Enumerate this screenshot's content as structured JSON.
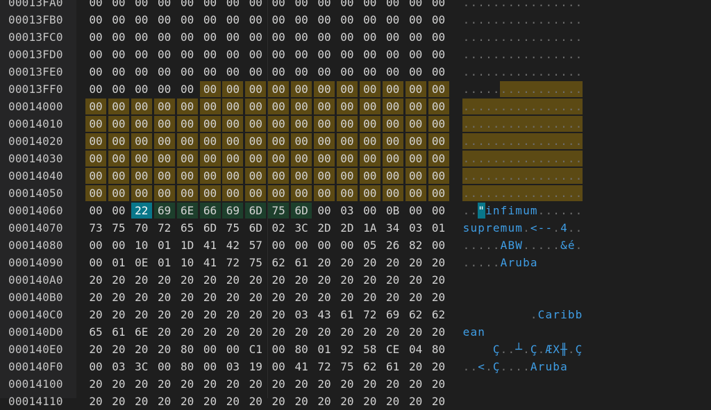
{
  "hex_editor": {
    "rows": [
      {
        "offset": "00013FA0",
        "bytes": [
          "00",
          "00",
          "00",
          "00",
          "00",
          "00",
          "00",
          "00",
          "00",
          "00",
          "00",
          "00",
          "00",
          "00",
          "00",
          "00"
        ],
        "ascii": "................"
      },
      {
        "offset": "00013FB0",
        "bytes": [
          "00",
          "00",
          "00",
          "00",
          "00",
          "00",
          "00",
          "00",
          "00",
          "00",
          "00",
          "00",
          "00",
          "00",
          "00",
          "00"
        ],
        "ascii": "................"
      },
      {
        "offset": "00013FC0",
        "bytes": [
          "00",
          "00",
          "00",
          "00",
          "00",
          "00",
          "00",
          "00",
          "00",
          "00",
          "00",
          "00",
          "00",
          "00",
          "00",
          "00"
        ],
        "ascii": "................"
      },
      {
        "offset": "00013FD0",
        "bytes": [
          "00",
          "00",
          "00",
          "00",
          "00",
          "00",
          "00",
          "00",
          "00",
          "00",
          "00",
          "00",
          "00",
          "00",
          "00",
          "00"
        ],
        "ascii": "................"
      },
      {
        "offset": "00013FE0",
        "bytes": [
          "00",
          "00",
          "00",
          "00",
          "00",
          "00",
          "00",
          "00",
          "00",
          "00",
          "00",
          "00",
          "00",
          "00",
          "00",
          "00"
        ],
        "ascii": "................"
      },
      {
        "offset": "00013FF0",
        "bytes": [
          "00",
          "00",
          "00",
          "00",
          "00",
          "00",
          "00",
          "00",
          "00",
          "00",
          "00",
          "00",
          "00",
          "00",
          "00",
          "00"
        ],
        "ascii": "................"
      },
      {
        "offset": "00014000",
        "bytes": [
          "00",
          "00",
          "00",
          "00",
          "00",
          "00",
          "00",
          "00",
          "00",
          "00",
          "00",
          "00",
          "00",
          "00",
          "00",
          "00"
        ],
        "ascii": "................"
      },
      {
        "offset": "00014010",
        "bytes": [
          "00",
          "00",
          "00",
          "00",
          "00",
          "00",
          "00",
          "00",
          "00",
          "00",
          "00",
          "00",
          "00",
          "00",
          "00",
          "00"
        ],
        "ascii": "................"
      },
      {
        "offset": "00014020",
        "bytes": [
          "00",
          "00",
          "00",
          "00",
          "00",
          "00",
          "00",
          "00",
          "00",
          "00",
          "00",
          "00",
          "00",
          "00",
          "00",
          "00"
        ],
        "ascii": "................"
      },
      {
        "offset": "00014030",
        "bytes": [
          "00",
          "00",
          "00",
          "00",
          "00",
          "00",
          "00",
          "00",
          "00",
          "00",
          "00",
          "00",
          "00",
          "00",
          "00",
          "00"
        ],
        "ascii": "................"
      },
      {
        "offset": "00014040",
        "bytes": [
          "00",
          "00",
          "00",
          "00",
          "00",
          "00",
          "00",
          "00",
          "00",
          "00",
          "00",
          "00",
          "00",
          "00",
          "00",
          "00"
        ],
        "ascii": "................"
      },
      {
        "offset": "00014050",
        "bytes": [
          "00",
          "00",
          "00",
          "00",
          "00",
          "00",
          "00",
          "00",
          "00",
          "00",
          "00",
          "00",
          "00",
          "00",
          "00",
          "00"
        ],
        "ascii": "................"
      },
      {
        "offset": "00014060",
        "bytes": [
          "00",
          "00",
          "22",
          "69",
          "6E",
          "66",
          "69",
          "6D",
          "75",
          "6D",
          "00",
          "03",
          "00",
          "0B",
          "00",
          "00"
        ],
        "ascii": "..\"infimum......"
      },
      {
        "offset": "00014070",
        "bytes": [
          "73",
          "75",
          "70",
          "72",
          "65",
          "6D",
          "75",
          "6D",
          "02",
          "3C",
          "2D",
          "2D",
          "1A",
          "34",
          "03",
          "01"
        ],
        "ascii": "supremum.<--.4.."
      },
      {
        "offset": "00014080",
        "bytes": [
          "00",
          "00",
          "10",
          "01",
          "1D",
          "41",
          "42",
          "57",
          "00",
          "00",
          "00",
          "00",
          "05",
          "26",
          "82",
          "00"
        ],
        "ascii": ".....ABW.....&é."
      },
      {
        "offset": "00014090",
        "bytes": [
          "00",
          "01",
          "0E",
          "01",
          "10",
          "41",
          "72",
          "75",
          "62",
          "61",
          "20",
          "20",
          "20",
          "20",
          "20",
          "20"
        ],
        "ascii": ".....Aruba      "
      },
      {
        "offset": "000140A0",
        "bytes": [
          "20",
          "20",
          "20",
          "20",
          "20",
          "20",
          "20",
          "20",
          "20",
          "20",
          "20",
          "20",
          "20",
          "20",
          "20",
          "20"
        ],
        "ascii": "                "
      },
      {
        "offset": "000140B0",
        "bytes": [
          "20",
          "20",
          "20",
          "20",
          "20",
          "20",
          "20",
          "20",
          "20",
          "20",
          "20",
          "20",
          "20",
          "20",
          "20",
          "20"
        ],
        "ascii": "                "
      },
      {
        "offset": "000140C0",
        "bytes": [
          "20",
          "20",
          "20",
          "20",
          "20",
          "20",
          "20",
          "20",
          "20",
          "03",
          "43",
          "61",
          "72",
          "69",
          "62",
          "62"
        ],
        "ascii": "         .Caribb"
      },
      {
        "offset": "000140D0",
        "bytes": [
          "65",
          "61",
          "6E",
          "20",
          "20",
          "20",
          "20",
          "20",
          "20",
          "20",
          "20",
          "20",
          "20",
          "20",
          "20",
          "20"
        ],
        "ascii": "ean             "
      },
      {
        "offset": "000140E0",
        "bytes": [
          "20",
          "20",
          "20",
          "20",
          "80",
          "00",
          "00",
          "C1",
          "00",
          "80",
          "01",
          "92",
          "58",
          "CE",
          "04",
          "80"
        ],
        "ascii": "    Ç..┴.Ç.ÆX╫.Ç"
      },
      {
        "offset": "000140F0",
        "bytes": [
          "00",
          "03",
          "3C",
          "00",
          "80",
          "00",
          "03",
          "19",
          "00",
          "41",
          "72",
          "75",
          "62",
          "61",
          "20",
          "20"
        ],
        "ascii": "..<.Ç....Aruba  "
      },
      {
        "offset": "00014100",
        "bytes": [
          "20",
          "20",
          "20",
          "20",
          "20",
          "20",
          "20",
          "20",
          "20",
          "20",
          "20",
          "20",
          "20",
          "20",
          "20",
          "20"
        ],
        "ascii": "                "
      },
      {
        "offset": "00014110",
        "bytes": [
          "20",
          "20",
          "20",
          "20",
          "20",
          "20",
          "20",
          "20",
          "20",
          "20",
          "20",
          "20",
          "20",
          "20",
          "20",
          "20"
        ],
        "ascii": "                "
      }
    ],
    "colors": {
      "background": "#1e1e1e",
      "gutter": "#252526",
      "selection": "#5c4a14",
      "highlight": "#1d3f2c",
      "cursor": "#09778a",
      "ascii_text": "#3f9ee6",
      "dot_text": "#6e6e6e"
    }
  }
}
